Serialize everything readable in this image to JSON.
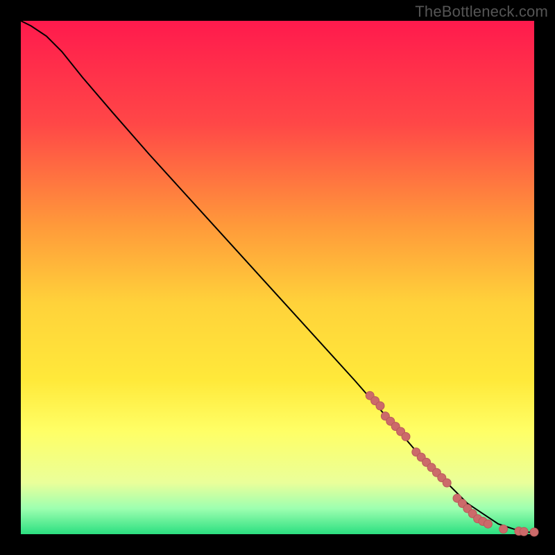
{
  "watermark": "TheBottleneck.com",
  "colors": {
    "frame": "#000000",
    "curve": "#000000",
    "dot_fill": "#cc6a6a",
    "dot_stroke": "#b85a5a",
    "gradient_stops": [
      {
        "pct": 0,
        "color": "#ff1a4d"
      },
      {
        "pct": 20,
        "color": "#ff4747"
      },
      {
        "pct": 40,
        "color": "#ff9a3a"
      },
      {
        "pct": 55,
        "color": "#ffd23a"
      },
      {
        "pct": 70,
        "color": "#ffe93a"
      },
      {
        "pct": 80,
        "color": "#ffff66"
      },
      {
        "pct": 90,
        "color": "#eaff9a"
      },
      {
        "pct": 95,
        "color": "#9dffb0"
      },
      {
        "pct": 100,
        "color": "#2bdf80"
      }
    ]
  },
  "chart_data": {
    "type": "line",
    "title": "",
    "xlabel": "",
    "ylabel": "",
    "xlim": [
      0,
      100
    ],
    "ylim": [
      0,
      100
    ],
    "grid": false,
    "legend": false,
    "series": [
      {
        "name": "curve",
        "x": [
          0,
          2,
          5,
          8,
          12,
          18,
          25,
          35,
          45,
          55,
          65,
          72,
          78,
          83,
          87,
          90,
          93,
          96,
          98,
          100
        ],
        "y": [
          100,
          99,
          97,
          94,
          89,
          82,
          74,
          63,
          52,
          41,
          30,
          22,
          15,
          10,
          6,
          4,
          2,
          1,
          0.5,
          0.3
        ]
      }
    ],
    "scatter": {
      "name": "dots",
      "x": [
        68,
        69,
        70,
        71,
        72,
        73,
        74,
        75,
        77,
        78,
        79,
        80,
        81,
        82,
        83,
        85,
        86,
        87,
        88,
        89,
        90,
        91,
        94,
        97,
        98,
        100
      ],
      "y": [
        27,
        26,
        25,
        23,
        22,
        21,
        20,
        19,
        16,
        15,
        14,
        13,
        12,
        11,
        10,
        7,
        6,
        5,
        4,
        3,
        2.5,
        2,
        1,
        0.6,
        0.5,
        0.4
      ]
    }
  }
}
